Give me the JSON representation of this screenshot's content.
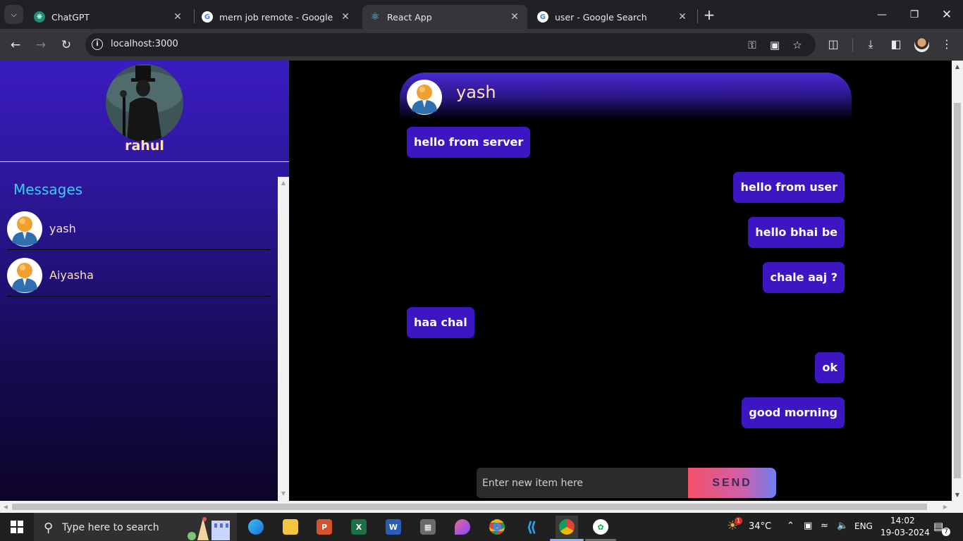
{
  "browser": {
    "tabs": [
      {
        "title": "ChatGPT",
        "active": false,
        "favicon": "chatgpt-icon"
      },
      {
        "title": "mern job remote - Google Search",
        "active": false,
        "favicon": "google-icon"
      },
      {
        "title": "React App",
        "active": true,
        "favicon": "react-icon"
      },
      {
        "title": "user - Google Search",
        "active": false,
        "favicon": "google-icon"
      }
    ],
    "url": "localhost:3000"
  },
  "app": {
    "current_user": {
      "name": "rahul"
    },
    "sidebar": {
      "heading": "Messages",
      "contacts": [
        {
          "name": "yash"
        },
        {
          "name": "Aiyasha"
        }
      ]
    },
    "chat": {
      "header_name": "yash",
      "messages": [
        {
          "text": "hello from server",
          "direction": "in"
        },
        {
          "text": "hello from user",
          "direction": "out"
        },
        {
          "text": "hello bhai be",
          "direction": "out"
        },
        {
          "text": "chale aaj ?",
          "direction": "out"
        },
        {
          "text": "haa chal",
          "direction": "in"
        },
        {
          "text": "ok",
          "direction": "out"
        },
        {
          "text": "good morning",
          "direction": "out"
        }
      ],
      "input_placeholder": "Enter new item here",
      "send_label": "SEND"
    },
    "colors": {
      "bubble": "#3d16c4",
      "sidebar_top": "#3a1cc0",
      "name_text": "#ffe0b8",
      "heading": "#36d0f0"
    }
  },
  "taskbar": {
    "search_placeholder": "Type here to search",
    "weather": "34°C",
    "language": "ENG",
    "time": "14:02",
    "date": "19-03-2024",
    "notification_count": "7",
    "weather_badge": "1"
  }
}
